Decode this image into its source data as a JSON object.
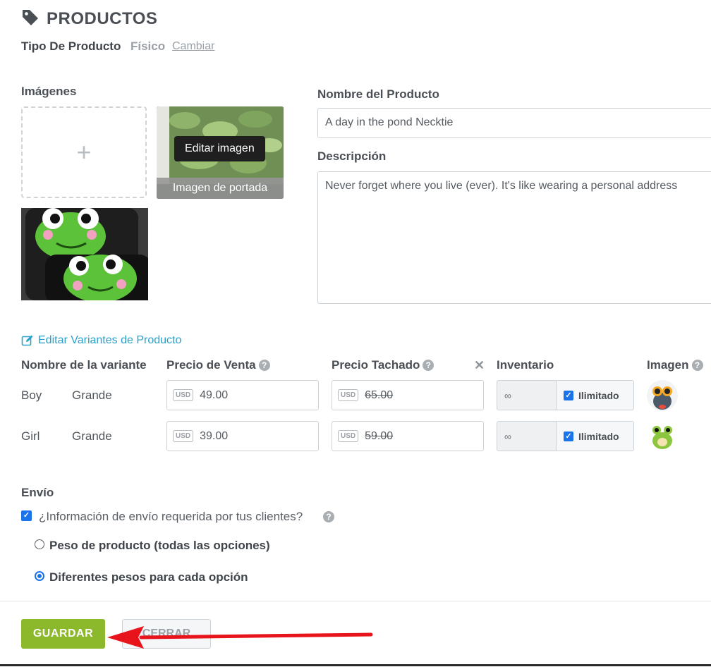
{
  "header": {
    "title": "PRODUCTOS",
    "icon": "tag-icon"
  },
  "product_type": {
    "label": "Tipo De Producto",
    "value": "Físico",
    "change_link": "Cambiar"
  },
  "images": {
    "label": "Imágenes",
    "add_symbol": "+",
    "edit_tooltip": "Editar imagen",
    "cover_label": "Imagen de portada"
  },
  "product_name": {
    "label": "Nombre del Producto",
    "value": "A day in the pond Necktie"
  },
  "description": {
    "label": "Descripción",
    "value": "Never forget where you live (ever). It's like wearing a personal address"
  },
  "variants": {
    "edit_link": "Editar Variantes de Producto",
    "headers": {
      "name": "Nombre de la variante",
      "sale_price": "Precio de Venta",
      "strike_price": "Precio Tachado",
      "inventory": "Inventario",
      "image": "Imagen"
    },
    "currency": "USD",
    "rows": [
      {
        "name": "Boy",
        "size": "Grande",
        "price": "49.00",
        "strike": "65.00",
        "inventory": "∞",
        "unlimited": "Ilimitado"
      },
      {
        "name": "Girl",
        "size": "Grande",
        "price": "39.00",
        "strike": "59.00",
        "inventory": "∞",
        "unlimited": "Ilimitado"
      }
    ]
  },
  "shipping": {
    "label": "Envío",
    "question": "¿Información de envío requerida por tus clientes?",
    "options": [
      "Peso de producto (todas las opciones)",
      "Diferentes pesos para cada opción"
    ],
    "selected": 1
  },
  "footer": {
    "save_label": "GUARDAR",
    "cancel_label": "CERRAR"
  },
  "colors": {
    "accent": "#8cb82b",
    "link": "#2aa1c9",
    "checkbox": "#1a73e8",
    "arrow": "#e8141b"
  }
}
